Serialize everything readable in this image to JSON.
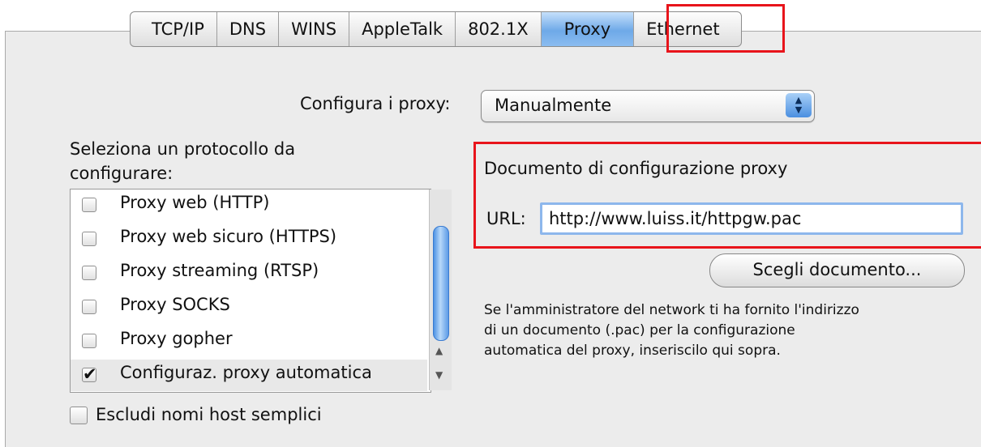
{
  "tabs": [
    {
      "label": "TCP/IP"
    },
    {
      "label": "DNS"
    },
    {
      "label": "WINS"
    },
    {
      "label": "AppleTalk"
    },
    {
      "label": "802.1X"
    },
    {
      "label": "Proxy",
      "selected": true
    },
    {
      "label": "Ethernet"
    }
  ],
  "configure": {
    "label": "Configura i proxy:",
    "value": "Manualmente"
  },
  "protocols": {
    "heading_line1": "Seleziona un protocollo da",
    "heading_line2": "configurare:",
    "items": [
      {
        "label": "Proxy web (HTTP)",
        "checked": false
      },
      {
        "label": "Proxy web sicuro (HTTPS)",
        "checked": false
      },
      {
        "label": "Proxy streaming (RTSP)",
        "checked": false
      },
      {
        "label": "Proxy SOCKS",
        "checked": false
      },
      {
        "label": "Proxy gopher",
        "checked": false
      },
      {
        "label": "Configuraz. proxy automatica",
        "checked": true,
        "check_mark": "✔"
      }
    ]
  },
  "exclude": {
    "label": "Escludi nomi host semplici",
    "checked": false
  },
  "pac": {
    "title": "Documento di configurazione proxy",
    "url_label": "URL:",
    "url_value": "http://www.luiss.it/httpgw.pac",
    "choose_button": "Scegli documento...",
    "help_line1": "Se l'amministratore del network ti ha fornito l'indirizzo",
    "help_line2": "di un documento (.pac) per la configurazione",
    "help_line3": "automatica del proxy, inseriscilo qui sopra."
  },
  "icons": {
    "popup_arrows": "updown-arrows-icon",
    "scroll_up": "scroll-up-arrow-icon",
    "scroll_down": "scroll-down-arrow-icon"
  },
  "colors": {
    "highlight_box": "#e8141b",
    "selected_tab": "#6ea9e8",
    "focus_ring": "#8db7ec"
  }
}
